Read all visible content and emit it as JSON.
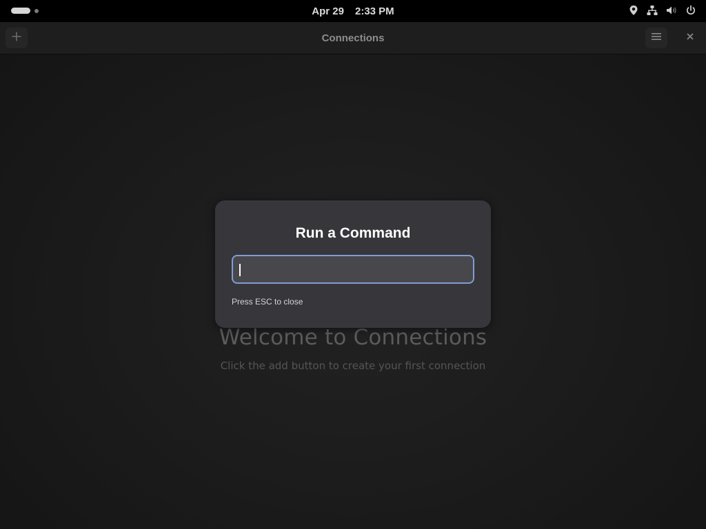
{
  "top_bar": {
    "date": "Apr 29",
    "time": "2:33 PM",
    "tray_icons": [
      "location-icon",
      "network-icon",
      "volume-icon",
      "power-icon"
    ]
  },
  "window": {
    "title": "Connections",
    "add_icon": "plus-icon",
    "menu_icon": "hamburger-menu-icon",
    "close_icon": "close-icon"
  },
  "welcome": {
    "title": "Welcome to Connections",
    "subtitle": "Click the add button to create your first connection"
  },
  "dialog": {
    "title": "Run a Command",
    "input_value": "",
    "hint": "Press ESC to close"
  },
  "colors": {
    "accent": "#7f9ed3",
    "dialog_bg": "#37373b",
    "window_bg": "#1c1c1c"
  }
}
